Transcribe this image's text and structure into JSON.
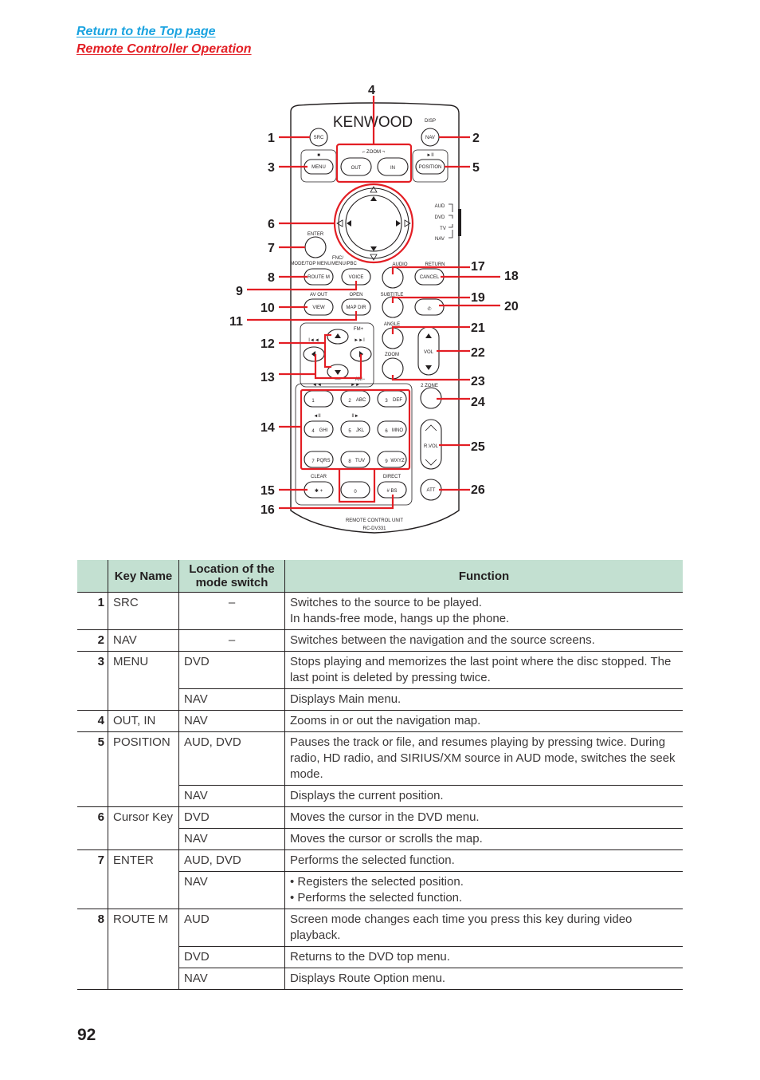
{
  "nav": {
    "return_top": "Return to the Top page",
    "section_link": "Remote Controller Operation"
  },
  "colors": {
    "link_blue": "#1aa3e0",
    "link_red": "#e31e24",
    "callout_red": "#e31e24",
    "header_green": "#c3e0d1"
  },
  "remote": {
    "brand": "KENWOOD",
    "model_caption": "REMOTE CONTROL UNIT",
    "model": "RC-DV331",
    "labels": {
      "disp": "DISP",
      "src": "SRC",
      "nav": "NAV",
      "stop_icon": "■",
      "playpause_icon": "►II",
      "zoom": "⌐ ZOOM ¬",
      "menu": "MENU",
      "out": "OUT",
      "in": "IN",
      "position": "POSITION",
      "aud": "AUD",
      "dvd": "DVD",
      "tv": "TV",
      "navsw": "NAV",
      "enter": "ENTER",
      "mode_top_menu": "MODE/TOP MENU",
      "fnc": "FNC/",
      "menu_pbc": "MENU/PBC",
      "audio": "AUDIO",
      "return": "RETURN",
      "route_m": "ROUTE M",
      "voice": "VOICE",
      "cancel": "CANCEL",
      "av_out": "AV OUT",
      "open": "OPEN",
      "subtitle": "SUBTITLE",
      "view": "VIEW",
      "map_dir": "MAP DIR",
      "phone_icon": "✆",
      "angle": "ANGLE",
      "fm_plus": "FM+",
      "am_minus": "AM−",
      "zoom2": "ZOOM",
      "vol": "VOL",
      "two_zone": "2 ZONE",
      "rvol": "R.VOL",
      "clear": "CLEAR",
      "direct": "DIRECT",
      "star": "✱ +",
      "zero": "0",
      "hash": "# BS",
      "att": "ATT",
      "k1": "1",
      "k2": "2",
      "k2s": "ABC",
      "k3": "3",
      "k3s": "DEF",
      "k4": "4",
      "k4s": "GHI",
      "k5": "5",
      "k5s": "JKL",
      "k6": "6",
      "k6s": "MNO",
      "k7": "7",
      "k7s": "PQRS",
      "k8": "8",
      "k8s": "TUV",
      "k9": "9",
      "k9s": "WXYZ",
      "prev": "I◄◄",
      "next": "►►I",
      "rew": "◄◄",
      "ff": "►►",
      "slow_rev": "◄II",
      "slow_fwd": "II►"
    },
    "callouts": [
      "1",
      "2",
      "3",
      "4",
      "5",
      "6",
      "7",
      "8",
      "9",
      "10",
      "11",
      "12",
      "13",
      "14",
      "15",
      "16",
      "17",
      "18",
      "19",
      "20",
      "21",
      "22",
      "23",
      "24",
      "25",
      "26"
    ]
  },
  "table": {
    "headers": {
      "num": "",
      "key_name": "Key Name",
      "location": "Location of the mode switch",
      "function": "Function"
    },
    "rows": [
      {
        "num": "1",
        "key": "SRC",
        "mode": "–",
        "func": [
          "Switches to the source to be played.",
          "In hands-free mode, hangs up the phone."
        ]
      },
      {
        "num": "2",
        "key": "NAV",
        "mode": "–",
        "func": [
          "Switches between the navigation and the source screens."
        ]
      },
      {
        "num": "3",
        "key": "MENU",
        "mode": "DVD",
        "func": [
          "Stops playing and memorizes the last point where the disc stopped. The last point is deleted by pressing twice."
        ]
      },
      {
        "num": "",
        "key": "",
        "mode": "NAV",
        "func": [
          "Displays Main menu."
        ]
      },
      {
        "num": "4",
        "key": "OUT, IN",
        "mode": "NAV",
        "func": [
          "Zooms in or out the navigation map."
        ]
      },
      {
        "num": "5",
        "key": "POSITION",
        "mode": "AUD, DVD",
        "func": [
          "Pauses the track or file, and resumes playing by pressing twice. During radio, HD radio, and SIRIUS/XM source in AUD mode, switches the seek mode."
        ]
      },
      {
        "num": "",
        "key": "",
        "mode": "NAV",
        "func": [
          "Displays the current position."
        ]
      },
      {
        "num": "6",
        "key": "Cursor Key",
        "mode": "DVD",
        "func": [
          "Moves the cursor in the DVD menu."
        ]
      },
      {
        "num": "",
        "key": "",
        "mode": "NAV",
        "func": [
          "Moves the cursor or scrolls the map."
        ]
      },
      {
        "num": "7",
        "key": "ENTER",
        "mode": "AUD, DVD",
        "func": [
          "Performs the selected function."
        ]
      },
      {
        "num": "",
        "key": "",
        "mode": "NAV",
        "func": [
          "• Registers the selected position.",
          "• Performs the selected function."
        ]
      },
      {
        "num": "8",
        "key": "ROUTE M",
        "mode": "AUD",
        "func": [
          "Screen mode changes each time you press this key during video playback."
        ]
      },
      {
        "num": "",
        "key": "",
        "mode": "DVD",
        "func": [
          "Returns to the DVD top menu."
        ]
      },
      {
        "num": "",
        "key": "",
        "mode": "NAV",
        "func": [
          "Displays Route Option menu."
        ]
      }
    ]
  },
  "page_number": "92"
}
